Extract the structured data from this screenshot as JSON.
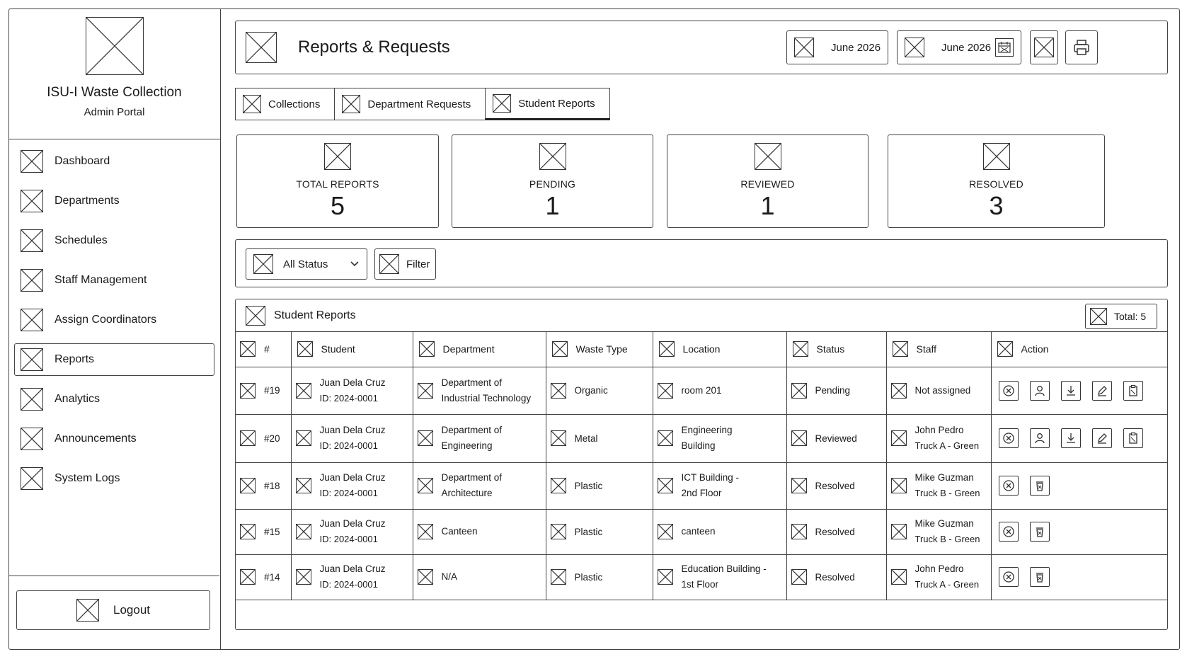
{
  "app": {
    "title": "ISU-I Waste Collection",
    "subtitle": "Admin Portal"
  },
  "sidebar": {
    "items": [
      {
        "label": "Dashboard",
        "name": "sidebar-item-dashboard"
      },
      {
        "label": "Departments",
        "name": "sidebar-item-departments"
      },
      {
        "label": "Schedules",
        "name": "sidebar-item-schedules"
      },
      {
        "label": "Staff Management",
        "name": "sidebar-item-staff-management"
      },
      {
        "label": "Assign Coordinators",
        "name": "sidebar-item-assign-coordinators"
      },
      {
        "label": "Reports",
        "name": "sidebar-item-reports"
      },
      {
        "label": "Analytics",
        "name": "sidebar-item-analytics"
      },
      {
        "label": "Announcements",
        "name": "sidebar-item-announcements"
      },
      {
        "label": "System Logs",
        "name": "sidebar-item-system-logs"
      }
    ],
    "active_index": 5,
    "logout_label": "Logout"
  },
  "header": {
    "title": "Reports & Requests",
    "month_button": "June 2026",
    "date_picker": "June 2026"
  },
  "tabs": [
    {
      "label": "Collections"
    },
    {
      "label": "Department Requests"
    },
    {
      "label": "Student Reports"
    }
  ],
  "active_tab": 2,
  "stats": [
    {
      "label": "TOTAL REPORTS",
      "value": "5"
    },
    {
      "label": "PENDING",
      "value": "1"
    },
    {
      "label": "REVIEWED",
      "value": "1"
    },
    {
      "label": "RESOLVED",
      "value": "3"
    }
  ],
  "filters": {
    "status_selected": "All Status",
    "filter_label": "Filter"
  },
  "table": {
    "title": "Student Reports",
    "total_label": "Total: 5",
    "columns": [
      "#",
      "Student",
      "Department",
      "Waste Type",
      "Location",
      "Status",
      "Staff",
      "Action"
    ],
    "rows": [
      {
        "id": "#19",
        "student": "Juan Dela Cruz",
        "student_id": "ID: 2024-0001",
        "department": [
          "Department of",
          "Industrial Technology"
        ],
        "waste": "Organic",
        "location": [
          "room 201"
        ],
        "status": "Pending",
        "staff": "Not assigned",
        "truck": "",
        "actions": [
          "reject-icon",
          "assign-staff-icon",
          "download-icon",
          "edit-icon",
          "clipboard-icon"
        ]
      },
      {
        "id": "#20",
        "student": "Juan Dela Cruz",
        "student_id": "ID: 2024-0001",
        "department": [
          "Department of",
          "Engineering"
        ],
        "waste": "Metal",
        "location": [
          "Engineering",
          "Building"
        ],
        "status": "Reviewed",
        "staff": "John Pedro",
        "truck": "Truck A - Green",
        "actions": [
          "reject-icon",
          "assign-staff-icon",
          "download-icon",
          "edit-icon",
          "clipboard-icon"
        ]
      },
      {
        "id": "#18",
        "student": "Juan Dela Cruz",
        "student_id": "ID: 2024-0001",
        "department": [
          "Department of",
          "Architecture"
        ],
        "waste": "Plastic",
        "location": [
          "ICT Building -",
          "2nd Floor"
        ],
        "status": "Resolved",
        "staff": "Mike Guzman",
        "truck": "Truck B - Green",
        "actions": [
          "reject-icon",
          "recycle-icon"
        ]
      },
      {
        "id": "#15",
        "student": "Juan Dela Cruz",
        "student_id": "ID: 2024-0001",
        "department": [
          "Canteen"
        ],
        "waste": "Plastic",
        "location": [
          "canteen"
        ],
        "status": "Resolved",
        "staff": "Mike Guzman",
        "truck": "Truck B - Green",
        "actions": [
          "reject-icon",
          "recycle-icon"
        ]
      },
      {
        "id": "#14",
        "student": "Juan Dela Cruz",
        "student_id": "ID: 2024-0001",
        "department": [
          "N/A"
        ],
        "waste": "Plastic",
        "location": [
          "Education Building -",
          "1st Floor"
        ],
        "status": "Resolved",
        "staff": "John Pedro",
        "truck": "Truck A - Green",
        "actions": [
          "reject-icon",
          "recycle-icon"
        ]
      }
    ]
  }
}
